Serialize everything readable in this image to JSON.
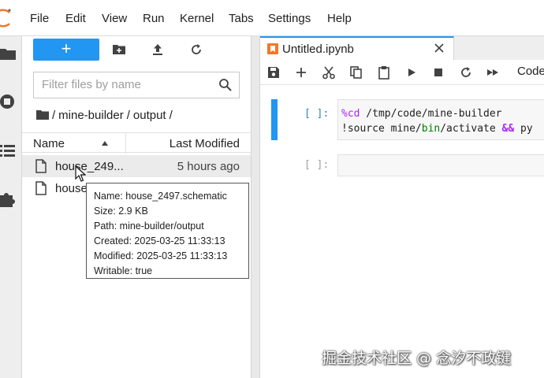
{
  "menubar": {
    "items": [
      "File",
      "Edit",
      "View",
      "Run",
      "Kernel",
      "Tabs",
      "Settings",
      "Help"
    ]
  },
  "colors": {
    "accent": "#2196f3",
    "logo": "#f37726"
  },
  "filebrowser": {
    "new_button": "+",
    "toolbar_icons": [
      "new-folder-icon",
      "upload-icon",
      "refresh-icon"
    ],
    "search_placeholder": "Filter files by name",
    "breadcrumb": [
      "mine-builder",
      "output"
    ],
    "columns": {
      "name": "Name",
      "last_modified": "Last Modified"
    },
    "files": [
      {
        "name": "house_249...",
        "modified": "5 hours ago",
        "selected": true
      },
      {
        "name": "house",
        "modified": "",
        "selected": false
      }
    ]
  },
  "tooltip": {
    "lines": [
      "Name: house_2497.schematic",
      "Size: 2.9 KB",
      "Path: mine-builder/output",
      "Created: 2025-03-25 11:33:13",
      "Modified: 2025-03-25 11:33:13",
      "Writable: true"
    ]
  },
  "notebook": {
    "tab_title": "Untitled.ipynb",
    "cell_type": "Code",
    "cells": [
      {
        "prompt": "[ ]:",
        "magic": "%cd",
        "line1_rest": " /tmp/code/mine-builder",
        "line2_a": "!source mine/",
        "line2_dir": "bin",
        "line2_b": "/activate ",
        "line2_op": "&&",
        "line2_c": " py"
      },
      {
        "prompt": "[ ]:"
      }
    ]
  },
  "watermark": "掘金技术社区 @ 念汐不政键"
}
